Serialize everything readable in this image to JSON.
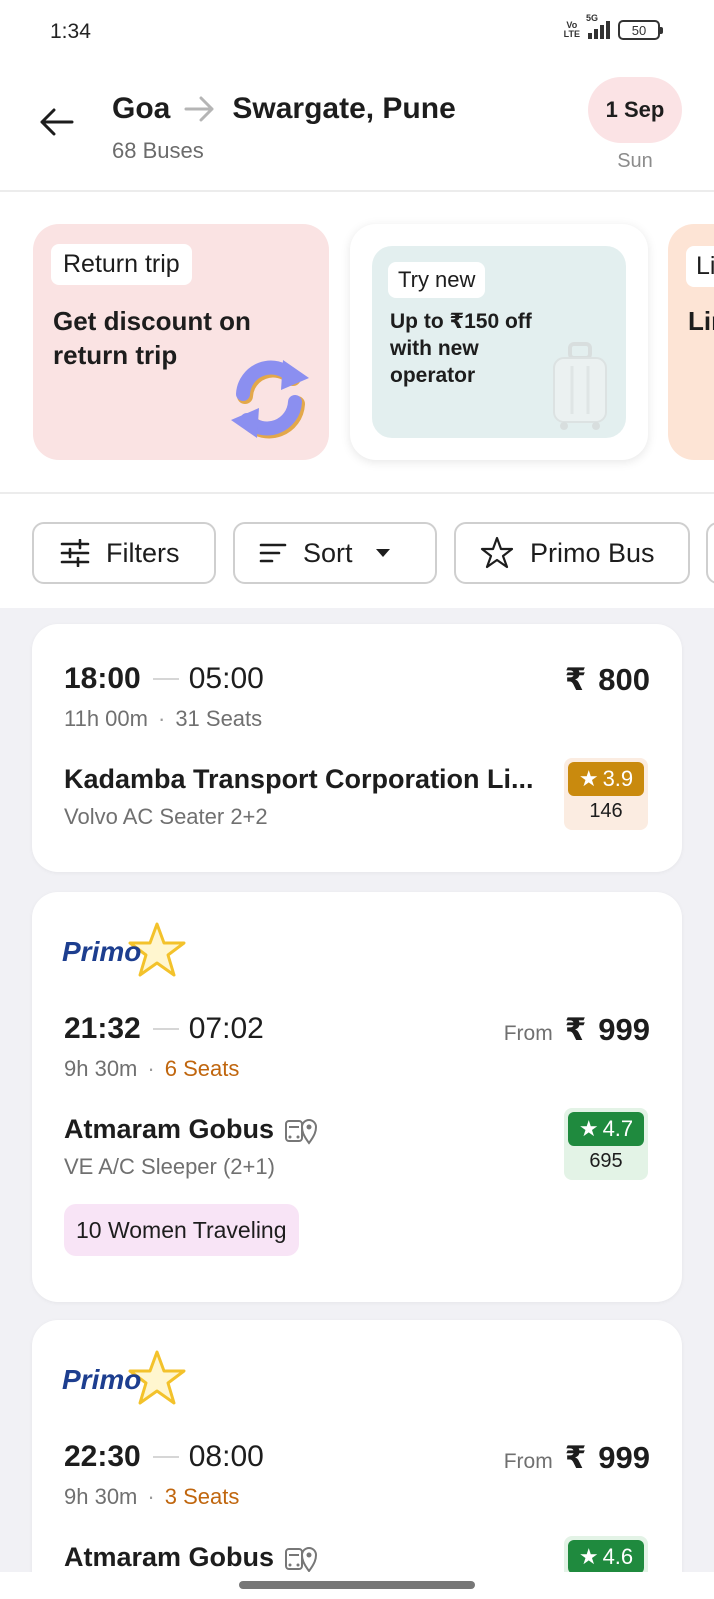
{
  "status_bar": {
    "time": "1:34",
    "volte_top": "Vo",
    "volte_bottom": "LTE",
    "network": "5G",
    "battery": "50"
  },
  "header": {
    "from": "Goa",
    "to": "Swargate, Pune",
    "bus_count": "68 Buses",
    "date": "1 Sep",
    "day": "Sun"
  },
  "offers": [
    {
      "tag": "Return trip",
      "text": "Get discount on return trip",
      "icon": "refresh-icon",
      "color": "#fae3e3"
    },
    {
      "tag": "Try new",
      "text": "Up to ₹150 off with new operator",
      "icon": "suitcase-icon",
      "color": "#e3efef"
    },
    {
      "tag": "Li",
      "text": "Lim sta",
      "color": "#fde4d5"
    }
  ],
  "chips": [
    {
      "label": "Filters",
      "icon": "filters-icon"
    },
    {
      "label": "Sort",
      "icon": "sort-icon"
    },
    {
      "label": "Primo Bus",
      "icon": "star-icon"
    }
  ],
  "buses": [
    {
      "departure": "18:00",
      "arrival": "05:00",
      "duration": "11h 00m",
      "seats": "31 Seats",
      "price_prefix": "",
      "currency": "₹",
      "price": "800",
      "operator": "Kadamba Transport Corporation Li...",
      "bus_type": "Volvo AC Seater 2+2",
      "rating": "3.9",
      "rating_count": "146"
    },
    {
      "primo": "Primo",
      "departure": "21:32",
      "arrival": "07:02",
      "duration": "9h 30m",
      "seats": "6 Seats",
      "price_prefix": "From",
      "currency": "₹",
      "price": "999",
      "operator": "Atmaram Gobus",
      "bus_type": "VE A/C Sleeper (2+1)",
      "rating": "4.7",
      "rating_count": "695",
      "tag": "10 Women Traveling"
    },
    {
      "primo": "Primo",
      "departure": "22:30",
      "arrival": "08:00",
      "duration": "9h 30m",
      "seats": "3 Seats",
      "price_prefix": "From",
      "currency": "₹",
      "price": "999",
      "operator": "Atmaram Gobus",
      "rating": "4.6"
    }
  ],
  "colors": {
    "rating_orange": "#c98a0e",
    "rating_green": "#1f8a3e",
    "seats_warning": "#c0660e",
    "primo_blue": "#1d3e8f",
    "date_pill": "#fbe3e5"
  }
}
